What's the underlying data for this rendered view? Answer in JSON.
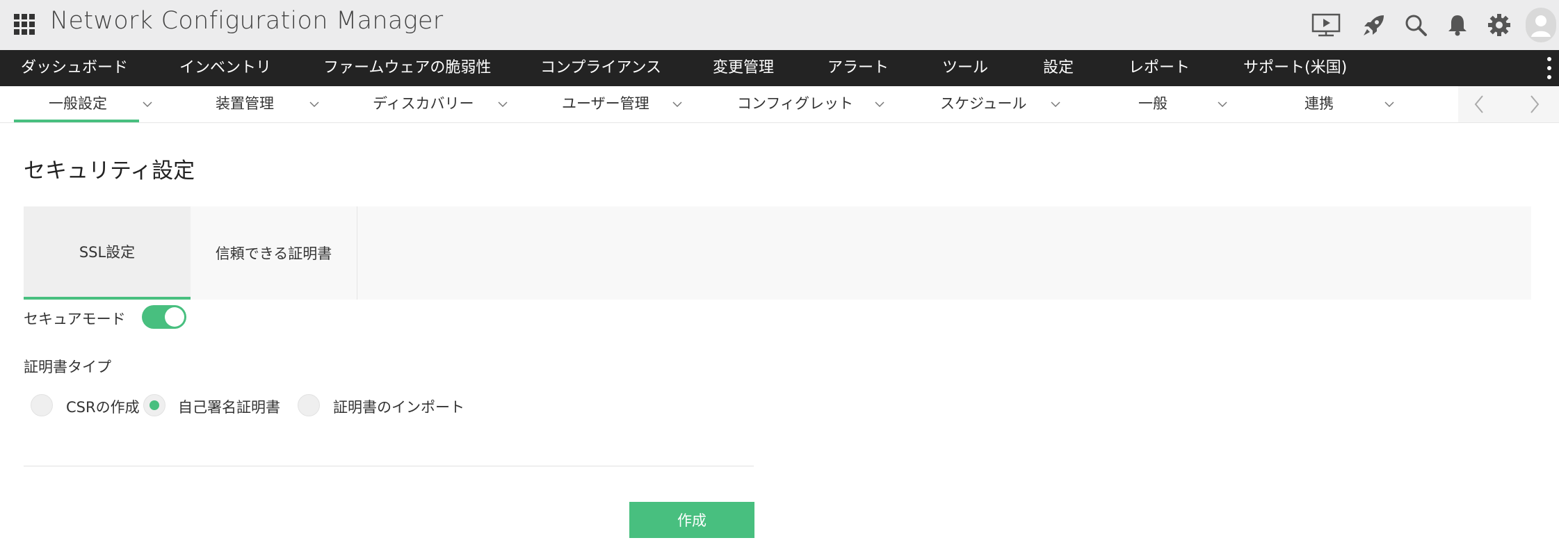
{
  "header": {
    "app_title": "Network Configuration Manager",
    "icons": [
      "apps-grid-icon",
      "presentation-icon",
      "rocket-icon",
      "search-icon",
      "bell-icon",
      "gear-icon",
      "user-avatar-icon"
    ]
  },
  "main_nav": {
    "items": [
      "ダッシュボード",
      "インベントリ",
      "ファームウェアの脆弱性",
      "コンプライアンス",
      "変更管理",
      "アラート",
      "ツール",
      "設定",
      "レポート",
      "サポート(米国)"
    ]
  },
  "sub_nav": {
    "items": [
      "一般設定",
      "装置管理",
      "ディスカバリー",
      "ユーザー管理",
      "コンフィグレット",
      "スケジュール",
      "一般",
      "連携"
    ],
    "active_index": 0
  },
  "page": {
    "title": "セキュリティ設定",
    "tabs": [
      "SSL設定",
      "信頼できる証明書"
    ],
    "active_tab": 0,
    "secure_mode_label": "セキュアモード",
    "secure_mode_on": true,
    "cert_type_label": "証明書タイプ",
    "cert_options": [
      "CSRの作成",
      "自己署名証明書",
      "証明書のインポート"
    ],
    "cert_selected_index": 1,
    "create_button": "作成"
  },
  "colors": {
    "accent": "#48bf7f",
    "nav_bg": "#232323",
    "header_bg": "#ececed"
  }
}
